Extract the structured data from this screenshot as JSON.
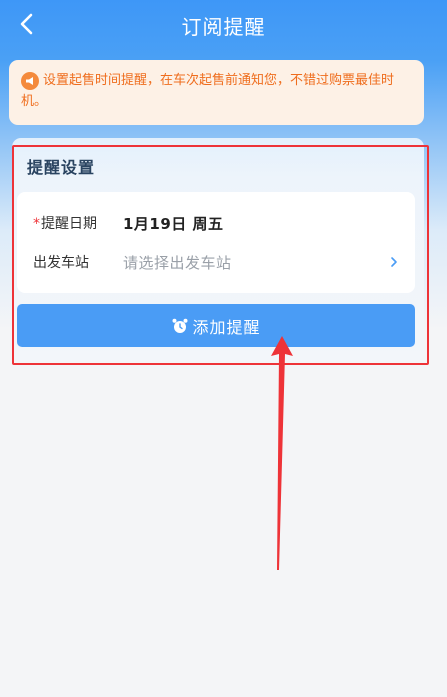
{
  "navbar": {
    "title": "订阅提醒"
  },
  "notice": {
    "icon": "megaphone-icon",
    "text": "设置起售时间提醒，在车次起售前通知您，不错过购票最佳时机。",
    "color": "#ef6d1d"
  },
  "settings": {
    "title": "提醒设置",
    "date_row": {
      "required_mark": "*",
      "label": "提醒日期",
      "value": "1月19日 周五"
    },
    "station_row": {
      "label": "出发车站",
      "placeholder": "请选择出发车站"
    },
    "add_button": {
      "label": "添加提醒",
      "color": "#4a9cf5"
    }
  },
  "colors": {
    "header_blue": "#3e97f7",
    "annotation_red": "#ee3338"
  }
}
